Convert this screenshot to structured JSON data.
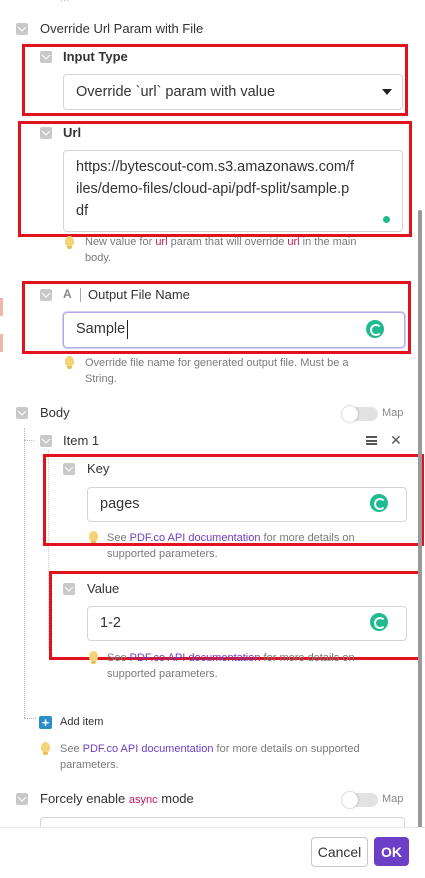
{
  "truncated_top_label": "...",
  "override_section": {
    "label": "Override Url Param with File"
  },
  "input_type": {
    "label": "Input Type",
    "value": "Override `url` param with value"
  },
  "url": {
    "label": "Url",
    "value_lines": [
      "https://bytescout-com.s3.amazonaws.com/f",
      "iles/demo-files/cloud-api/pdf-split/sample.p",
      "df"
    ],
    "hint_parts": [
      "New value for ",
      "url",
      " param that will override ",
      "url",
      " in the main",
      "body."
    ]
  },
  "output_file_name": {
    "type_glyph": "A",
    "label": "Output File Name",
    "value": "Sample",
    "hint_line1": "Override file name for generated output file. Must be a",
    "hint_line2": "String."
  },
  "body_section": {
    "label": "Body",
    "map_label": "Map"
  },
  "item": {
    "label": "Item 1"
  },
  "key": {
    "label": "Key",
    "value": "pages",
    "hint_parts": [
      "See ",
      "PDF.co API documentation",
      " for more details on",
      "supported parameters."
    ]
  },
  "value_field": {
    "label": "Value",
    "value": "1-2",
    "hint_parts": [
      "See ",
      "PDF.co API documentation",
      " for more details on",
      "supported parameters."
    ]
  },
  "add_item": {
    "label": "Add item"
  },
  "body_hint": {
    "parts": [
      "See ",
      "PDF.co API documentation",
      " for more details on supported",
      "parameters."
    ]
  },
  "async_section": {
    "label_prefix": "Forcely enable ",
    "code": "async",
    "label_suffix": " mode",
    "map_label": "Map"
  },
  "footer": {
    "cancel_label": "Cancel",
    "ok_label": "OK"
  },
  "colors": {
    "accent": "#6c3fc6",
    "highlight_red": "#e0121d",
    "green_badge": "#1fba8f"
  }
}
